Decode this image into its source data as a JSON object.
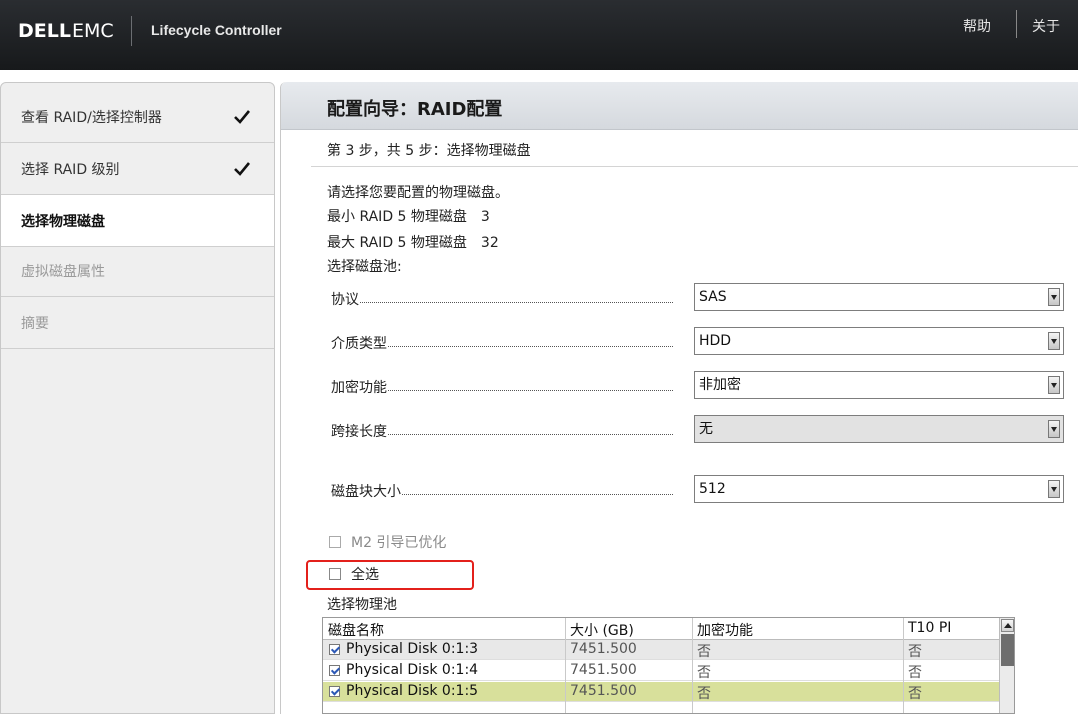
{
  "header": {
    "brand_dell": "DELL",
    "brand_emc": "EMC",
    "product": "Lifecycle Controller",
    "help_label": "帮助",
    "about_label": "关于"
  },
  "sidebar": {
    "items": [
      {
        "label": "查看 RAID/选择控制器",
        "state": "done"
      },
      {
        "label": "选择 RAID 级别",
        "state": "done"
      },
      {
        "label": "选择物理磁盘",
        "state": "current"
      },
      {
        "label": "虚拟磁盘属性",
        "state": "disabled"
      },
      {
        "label": "摘要",
        "state": "disabled"
      }
    ]
  },
  "main": {
    "title": "配置向导：RAID配置",
    "step": "第 3 步，共 5 步：选择物理磁盘",
    "instruction": "请选择您要配置的物理磁盘。",
    "min_label": "最小 RAID 5 物理磁盘",
    "min_value": "3",
    "max_label": "最大 RAID 5 物理磁盘",
    "max_value": "32",
    "pool_label": "选择磁盘池:",
    "fields": [
      {
        "label": "协议",
        "value": "SAS",
        "disabled": false
      },
      {
        "label": "介质类型",
        "value": "HDD",
        "disabled": false
      },
      {
        "label": "加密功能",
        "value": "非加密",
        "disabled": false
      },
      {
        "label": "跨接长度",
        "value": "无",
        "disabled": true
      },
      {
        "label": "磁盘块大小",
        "value": "512",
        "disabled": false
      }
    ],
    "m2_label": "M2 引导已优化",
    "select_all_label": "全选",
    "physical_pool_label": "选择物理池",
    "table": {
      "headers": [
        "磁盘名称",
        "大小 (GB)",
        "加密功能",
        "T10 PI"
      ],
      "rows": [
        {
          "name": "Physical Disk 0:1:3",
          "size": "7451.500",
          "encryption": "否",
          "t10": "否",
          "checked": true
        },
        {
          "name": "Physical Disk 0:1:4",
          "size": "7451.500",
          "encryption": "否",
          "t10": "否",
          "checked": true
        },
        {
          "name": "Physical Disk 0:1:5",
          "size": "7451.500",
          "encryption": "否",
          "t10": "否",
          "checked": true
        }
      ]
    }
  },
  "colors": {
    "header_bg": "#1d1f22",
    "selected_row": "#d8e09b",
    "highlight_box": "#e3201b",
    "checkbox_tick": "#2c58b6"
  }
}
